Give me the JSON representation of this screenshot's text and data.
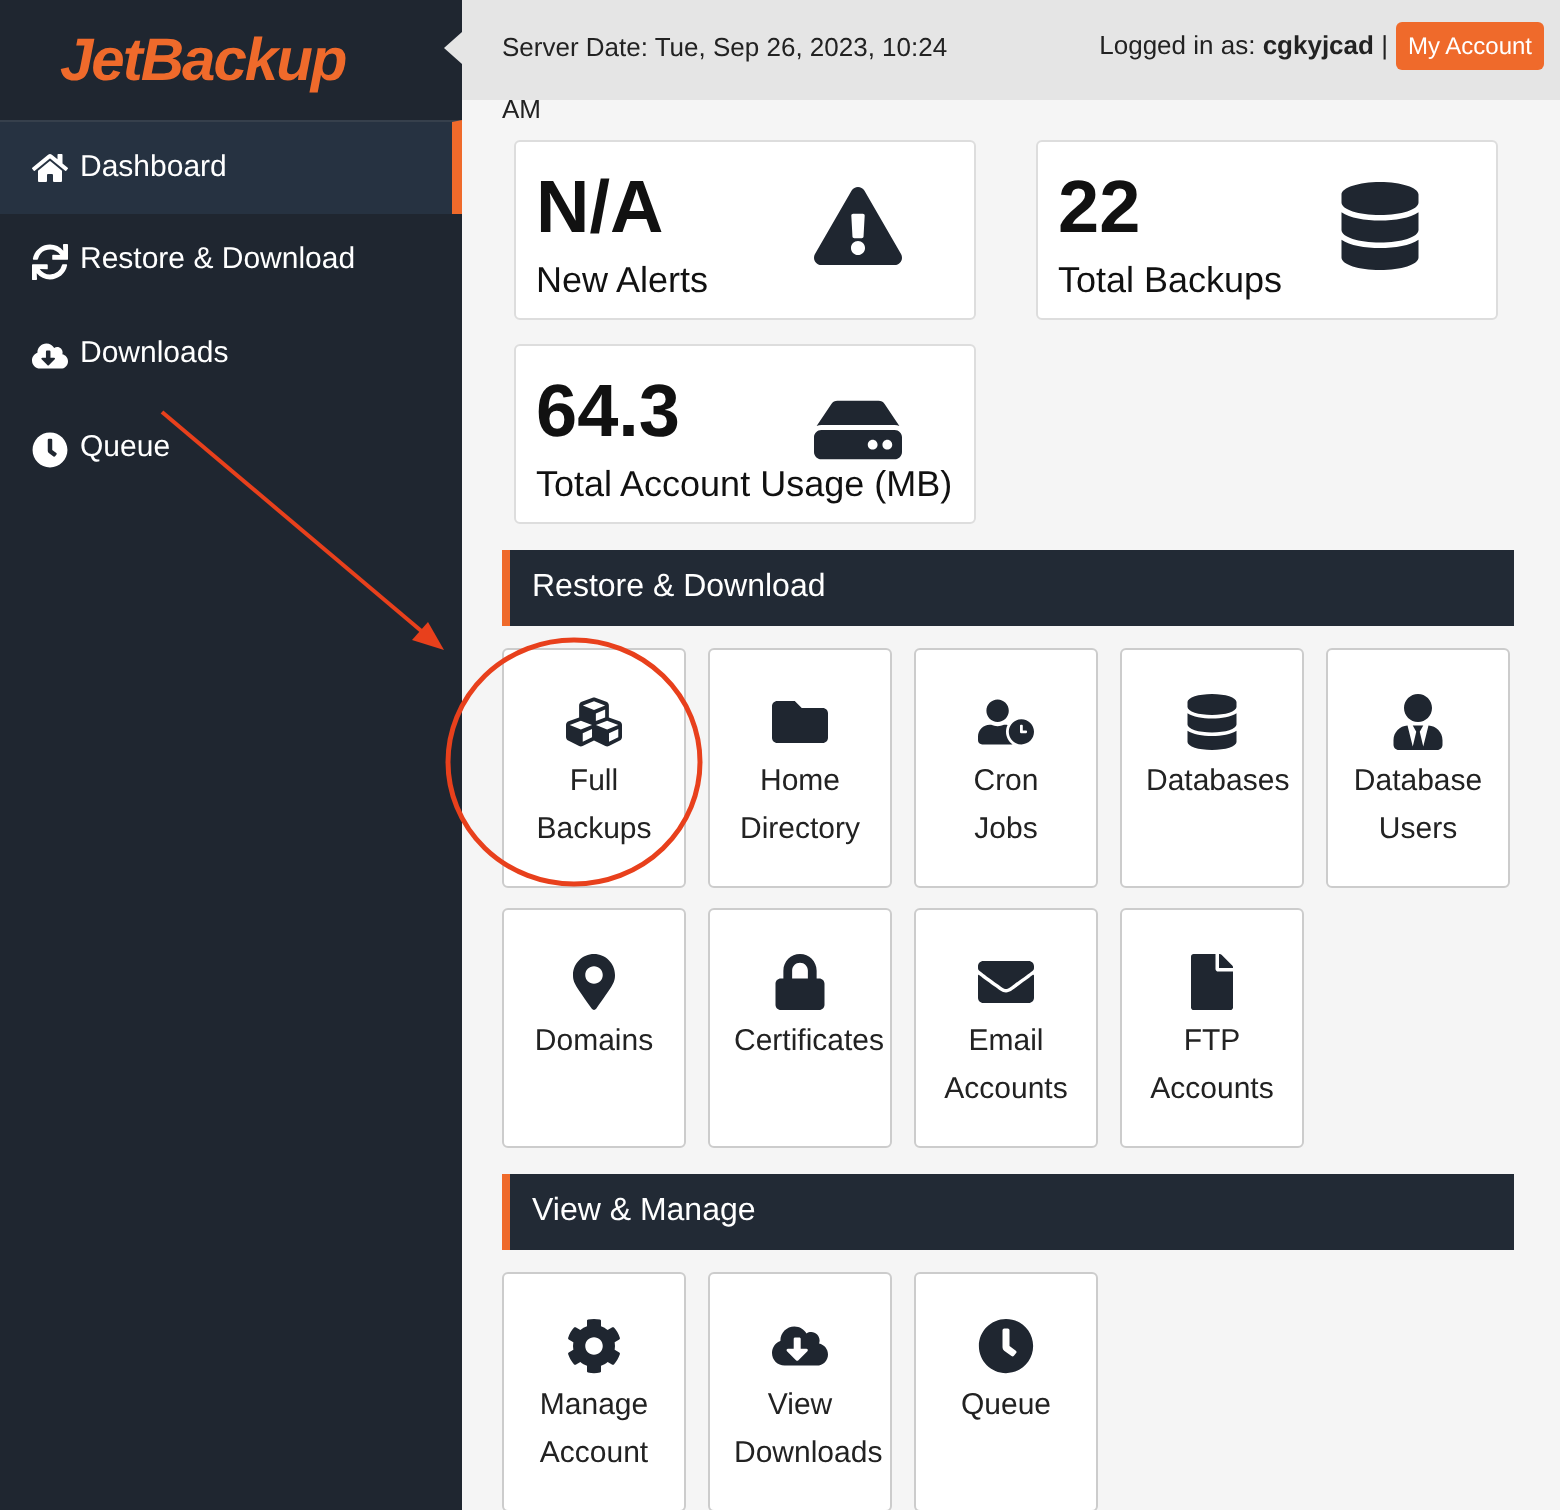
{
  "logo": "JetBackup",
  "sidebar": {
    "items": [
      {
        "label": "Dashboard",
        "selected": true
      },
      {
        "label": "Restore & Download",
        "selected": false
      },
      {
        "label": "Downloads",
        "selected": false
      },
      {
        "label": "Queue",
        "selected": false
      }
    ]
  },
  "header": {
    "server_date": "Server Date: Tue, Sep 26, 2023, 10:24 AM",
    "logged_in": "Logged in as: **cgkyjcad** |",
    "account_button": "My Account"
  },
  "stats": [
    {
      "value": "N/A",
      "label": "New Alerts"
    },
    {
      "value": "22",
      "label": "Total Backups"
    },
    {
      "value": "64.3",
      "label": "Total Account Usage (MB)"
    }
  ],
  "sections": [
    {
      "title": "Restore & Download",
      "tiles": [
        "Full Backups",
        "Home Directory",
        "Cron Jobs",
        "Databases",
        "Database Users",
        "Domains",
        "Certificates",
        "Email Accounts",
        "FTP Accounts"
      ]
    },
    {
      "title": "View & Manage",
      "tiles": [
        "Manage Account",
        "View Downloads",
        "Queue"
      ]
    }
  ]
}
